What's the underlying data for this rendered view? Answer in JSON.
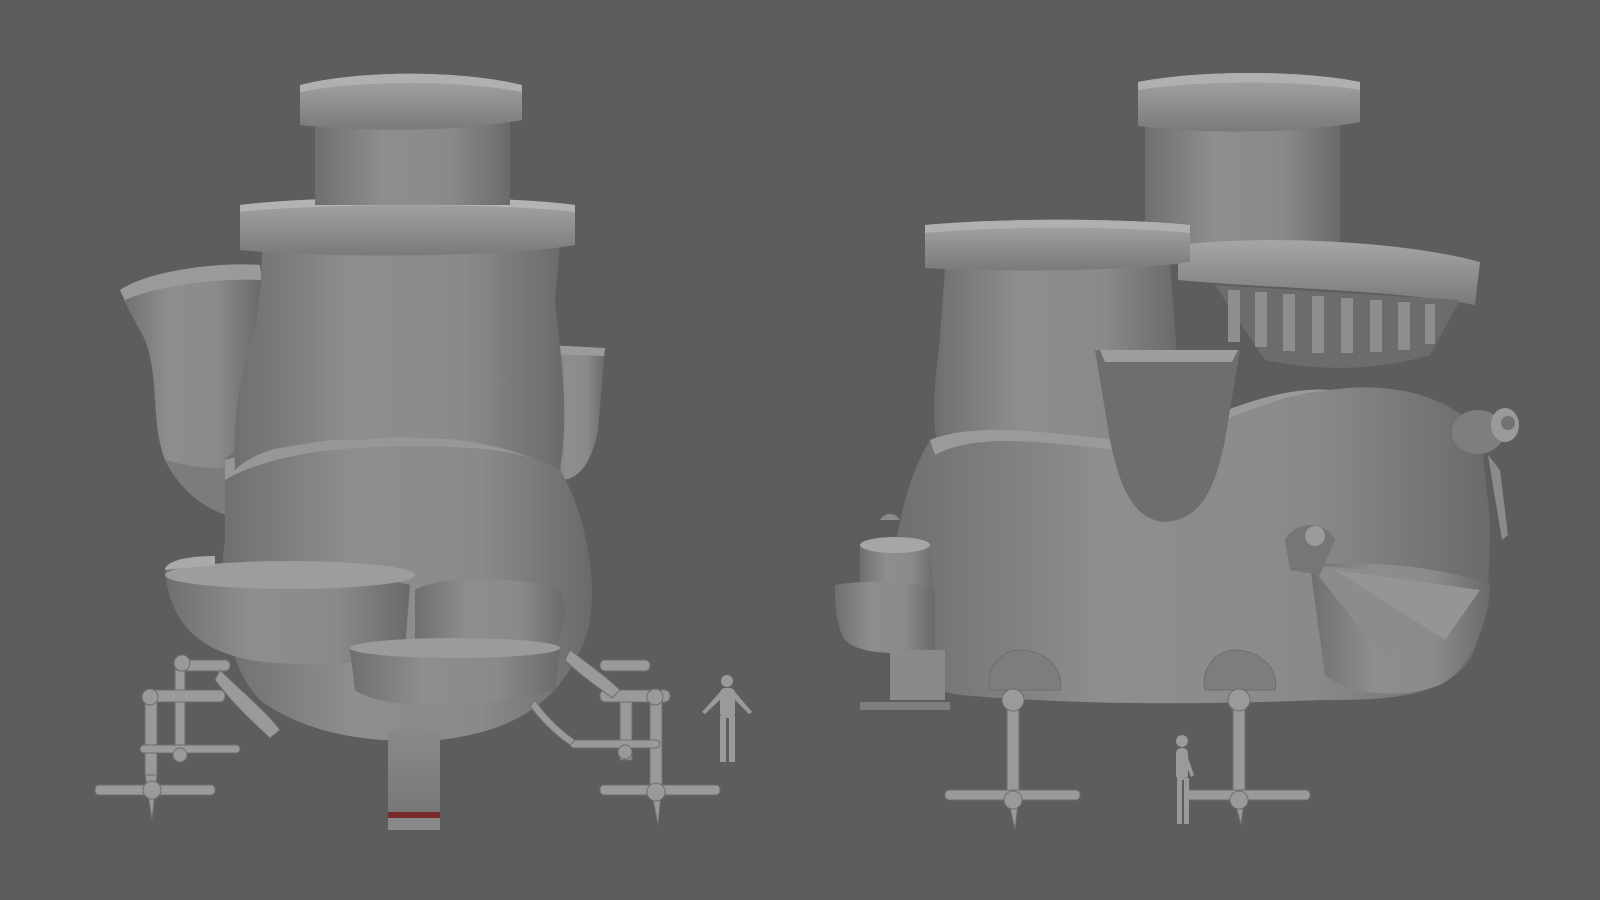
{
  "scene": {
    "background_color": "#5d5d5d",
    "model_color": "#8c8c8c",
    "views": [
      {
        "name": "front-view",
        "contents": [
          "castle-model",
          "scale-figure"
        ]
      },
      {
        "name": "side-view",
        "contents": [
          "castle-model",
          "scale-figure"
        ]
      }
    ]
  }
}
